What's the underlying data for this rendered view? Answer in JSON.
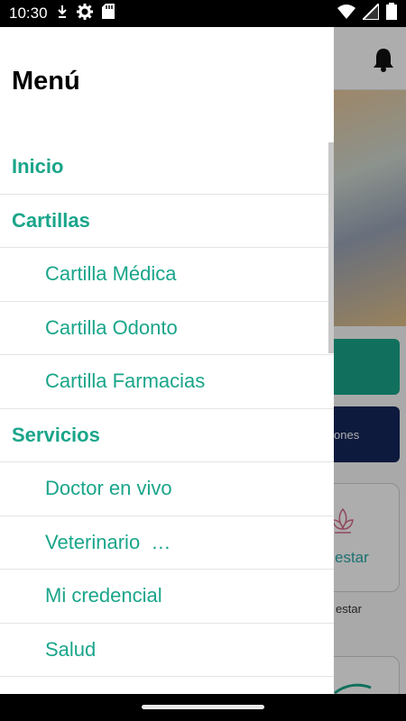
{
  "status_bar": {
    "time": "10:30",
    "left_icons": [
      "download-icon",
      "gear-icon",
      "sd-card-icon"
    ],
    "right_icons": [
      "wifi-icon",
      "signal-icon",
      "battery-icon"
    ]
  },
  "drawer": {
    "title": "Menú",
    "items": [
      {
        "label": "Inicio",
        "level": "section"
      },
      {
        "label": "Cartillas",
        "level": "section"
      },
      {
        "label": "Cartilla Médica",
        "level": "sub"
      },
      {
        "label": "Cartilla Odonto",
        "level": "sub"
      },
      {
        "label": "Cartilla Farmacias",
        "level": "sub"
      },
      {
        "label": "Servicios",
        "level": "section"
      },
      {
        "label": "Doctor en vivo",
        "level": "sub"
      },
      {
        "label": "Veterinario  …",
        "level": "sub"
      },
      {
        "label": "Mi credencial",
        "level": "sub"
      },
      {
        "label": "Salud",
        "level": "sub"
      }
    ]
  },
  "background": {
    "notification_icon": "bell-icon",
    "navy_button_text": "ones",
    "card_text": "estar",
    "card_caption": "estar",
    "colors": {
      "accent": "#1aa58a",
      "navy": "#16255c",
      "card_text": "#2aa7a8"
    }
  }
}
